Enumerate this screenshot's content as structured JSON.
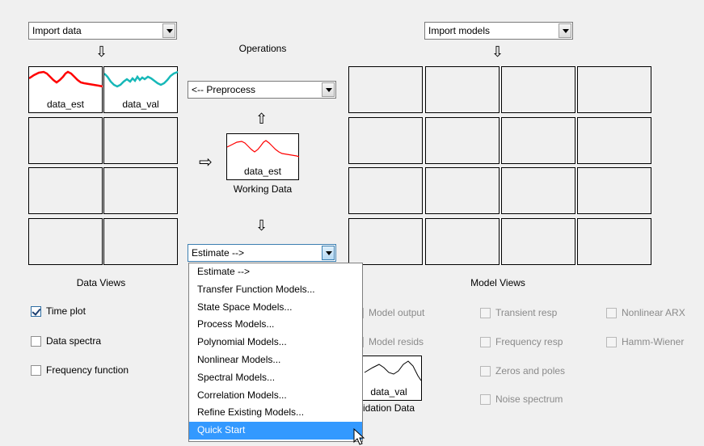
{
  "window": {
    "bg": "#f0f0f0"
  },
  "import_data": {
    "value": "Import data"
  },
  "import_models": {
    "value": "Import models"
  },
  "operations": {
    "title": "Operations"
  },
  "preprocess": {
    "value": "<-- Preprocess"
  },
  "estimate": {
    "value": "Estimate -->"
  },
  "data_board": {
    "tiles": [
      {
        "label": "data_est",
        "color": "#ff0000"
      },
      {
        "label": "data_val",
        "color": "#17b8b8"
      }
    ]
  },
  "working_data": {
    "tile_label": "data_est",
    "caption": "Working Data"
  },
  "validation_data": {
    "tile_label": "data_val",
    "caption": "idation Data"
  },
  "data_views": {
    "title": "Data Views",
    "checkboxes": [
      {
        "label": "Time plot",
        "checked": true
      },
      {
        "label": "Data spectra",
        "checked": false
      },
      {
        "label": "Frequency function",
        "checked": false
      }
    ]
  },
  "model_views": {
    "title": "Model Views",
    "checkboxes_col1": [
      {
        "label": "Model output"
      },
      {
        "label": "Model resids"
      }
    ],
    "checkboxes_col2": [
      {
        "label": "Transient resp"
      },
      {
        "label": "Frequency resp"
      },
      {
        "label": "Zeros and poles"
      },
      {
        "label": "Noise spectrum"
      }
    ],
    "checkboxes_col3": [
      {
        "label": "Nonlinear ARX"
      },
      {
        "label": "Hamm-Wiener"
      }
    ]
  },
  "estimate_menu": {
    "items": [
      "Estimate -->",
      "Transfer Function Models...",
      "State Space Models...",
      "Process Models...",
      "Polynomial Models...",
      "Nonlinear Models...",
      "Spectral Models...",
      "Correlation Models...",
      "Refine Existing Models...",
      "Quick Start"
    ],
    "selected": "Quick Start",
    "highlight_color": "#3399ff"
  }
}
